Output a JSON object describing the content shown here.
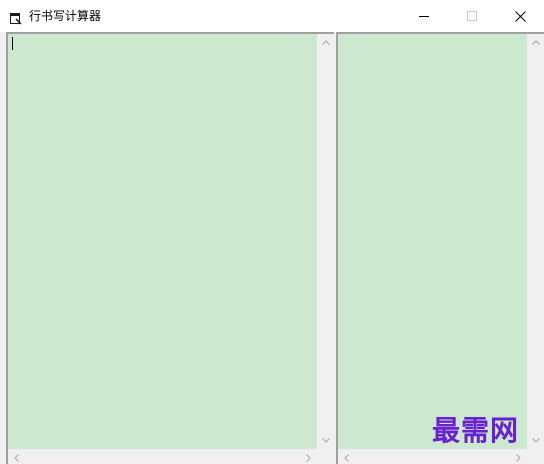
{
  "window": {
    "title": "行书写计算器",
    "icon": "app-window-icon",
    "controls": {
      "minimize_icon": "minimize-icon",
      "maximize_icon": "maximize-icon",
      "close_icon": "close-icon"
    }
  },
  "left_pane": {
    "text": "",
    "background": "#cce8cf"
  },
  "right_pane": {
    "text": "",
    "background": "#cce8cf"
  },
  "watermark": {
    "text": "最需网",
    "color": "#6a1fd0"
  }
}
